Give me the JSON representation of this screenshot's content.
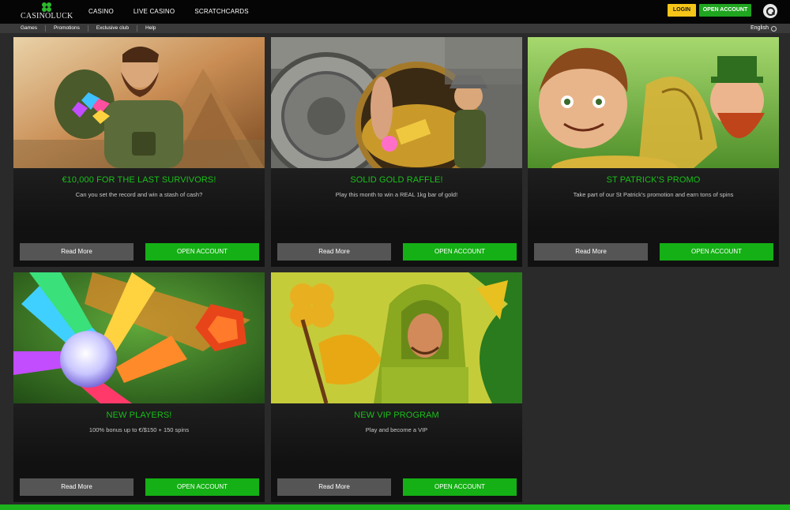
{
  "brand": {
    "logo_text": "CASINOLUCK"
  },
  "main_nav": [
    "CASINO",
    "LIVE CASINO",
    "SCRATCHCARDS"
  ],
  "header": {
    "login_label": "LOGIN",
    "open_account_label": "OPEN ACCOUNT",
    "search_icon": "search-icon"
  },
  "sub_nav": [
    "Games",
    "Promotions",
    "Exclusive club",
    "Help"
  ],
  "language": {
    "selected": "English"
  },
  "colors": {
    "accent_green": "#19c019",
    "button_green": "#15b015",
    "login_yellow": "#f5c518",
    "background": "#2a2a2a",
    "card": "#121212"
  },
  "promotions": [
    {
      "title": "€10,000 FOR THE LAST SURVIVORS!",
      "description": "Can you set the record and win a stash of cash?",
      "read_more": "Read More",
      "open_account": "OPEN ACCOUNT"
    },
    {
      "title": "SOLID GOLD RAFFLE!",
      "description": "Play this month to win a REAL 1kg bar of gold!",
      "read_more": "Read More",
      "open_account": "OPEN ACCOUNT"
    },
    {
      "title": "ST PATRICK'S PROMO",
      "description": "Take part of our St Patrick's promotion and earn tons of spins",
      "read_more": "Read More",
      "open_account": "OPEN ACCOUNT"
    },
    {
      "title": "NEW PLAYERS!",
      "description": "100% bonus up to €/$150 + 150 spins",
      "read_more": "Read More",
      "open_account": "OPEN ACCOUNT"
    },
    {
      "title": "NEW VIP PROGRAM",
      "description": "Play and become a VIP",
      "read_more": "Read More",
      "open_account": "OPEN ACCOUNT"
    }
  ]
}
